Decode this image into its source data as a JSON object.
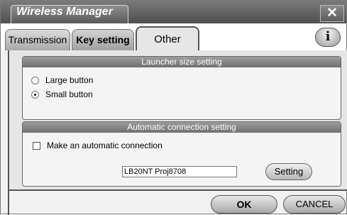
{
  "window": {
    "title": "Wireless Manager",
    "close_symbol": "✕",
    "close_icon": "close-icon"
  },
  "tabs": [
    {
      "label": "Transmission",
      "selected": false
    },
    {
      "label": "Key setting",
      "selected": false
    },
    {
      "label": "Other",
      "selected": true
    }
  ],
  "info_button": {
    "symbol": "i",
    "icon": "info-icon"
  },
  "launcher_group": {
    "title": "Launcher size setting",
    "options": [
      {
        "label": "Large button",
        "selected": false
      },
      {
        "label": "Small button",
        "selected": true
      }
    ]
  },
  "auto_group": {
    "title": "Automatic connection setting",
    "checkbox_label": "Make an automatic connection",
    "checkbox_checked": false,
    "input_value": "LB20NT Proj8708",
    "setting_button": "Setting"
  },
  "footer": {
    "ok_label": "OK",
    "cancel_label": "CANCEL"
  }
}
